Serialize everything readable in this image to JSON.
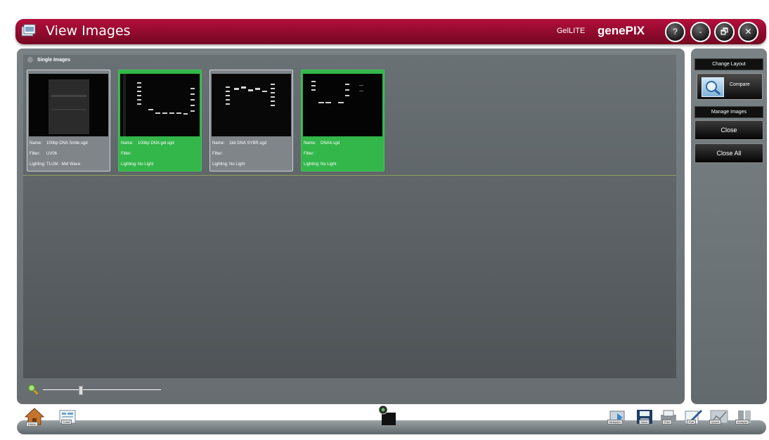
{
  "window": {
    "title": "View Images",
    "product": "GelLITE",
    "brand": "genePIX",
    "help_label": "?",
    "minimize_label": "-",
    "restore_label": "🗗",
    "close_label": "✕"
  },
  "gallery": {
    "group_label": "Single Images",
    "field_labels": {
      "name": "Name:",
      "filter": "Filter:",
      "lighting": "Lighting:"
    },
    "cards": [
      {
        "name": "100bp DNA Smile.sgd",
        "filter": "UV06",
        "lighting": "TLUM - Mid Wave",
        "selected": false
      },
      {
        "name": "100bp DNA gel.sgd",
        "filter": "",
        "lighting": "No Light",
        "selected": true
      },
      {
        "name": "1kb DNA SYBR.sgd",
        "filter": "",
        "lighting": "No Light",
        "selected": false
      },
      {
        "name": "DNA4.sgd",
        "filter": "",
        "lighting": "No Light",
        "selected": true
      }
    ]
  },
  "zoom": {
    "icon": "zoom-icon",
    "level": 0.32
  },
  "right_panel": {
    "change_layout_label": "Change Layout",
    "compare_label": "Compare",
    "manage_images_label": "Manage Images",
    "close_label": "Close",
    "close_all_label": "Close All"
  },
  "bottom_bar": {
    "home_label": "Home",
    "load_label": "Load",
    "multiplex_label": "Multiplex",
    "save_label": "Save",
    "print_label": "Print",
    "edit_label": "Edit",
    "quant_label": "Quant",
    "analyse_label": "Analyse"
  },
  "colors": {
    "titlebar": "#9e0c34",
    "selected_card": "#33b64a",
    "panel": "#6f767a"
  }
}
